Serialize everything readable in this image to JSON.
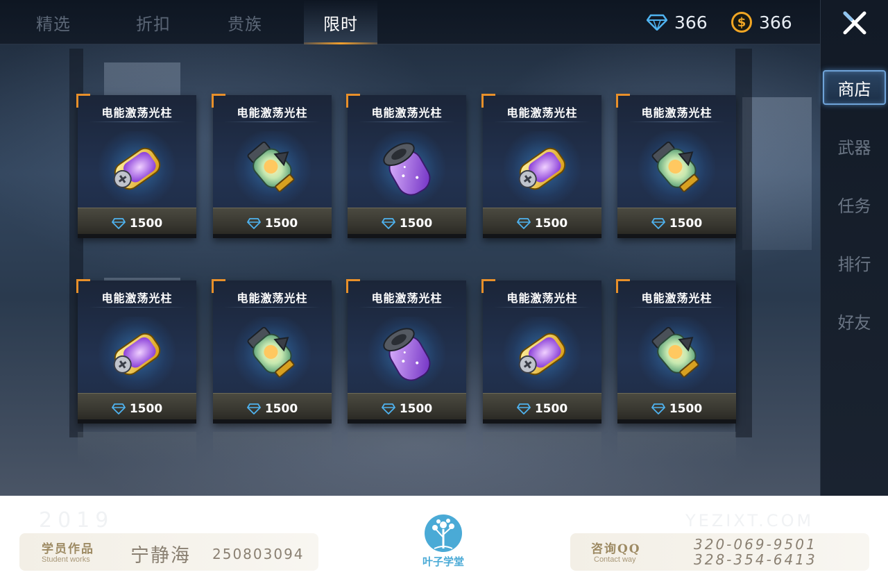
{
  "tabs": [
    {
      "label": "精选"
    },
    {
      "label": "折扣"
    },
    {
      "label": "贵族"
    },
    {
      "label": "限时"
    }
  ],
  "active_tab": "限时",
  "currency": {
    "diamonds": "366",
    "coins": "366",
    "coin_symbol": "$",
    "gem_color": "#4fb3f0",
    "coin_color": "#f1a624"
  },
  "side_nav": [
    {
      "label": "商店"
    },
    {
      "label": "武器"
    },
    {
      "label": "任务"
    },
    {
      "label": "排行"
    },
    {
      "label": "好友"
    }
  ],
  "active_nav": "商店",
  "items": [
    {
      "name": "电能激荡光柱",
      "price": "1500",
      "art": "yellow-capsule"
    },
    {
      "name": "电能激荡光柱",
      "price": "1500",
      "art": "green-bottle"
    },
    {
      "name": "电能激荡光柱",
      "price": "1500",
      "art": "purple-canister"
    },
    {
      "name": "电能激荡光柱",
      "price": "1500",
      "art": "yellow-capsule"
    },
    {
      "name": "电能激荡光柱",
      "price": "1500",
      "art": "green-bottle"
    },
    {
      "name": "电能激荡光柱",
      "price": "1500",
      "art": "yellow-capsule"
    },
    {
      "name": "电能激荡光柱",
      "price": "1500",
      "art": "green-bottle"
    },
    {
      "name": "电能激荡光柱",
      "price": "1500",
      "art": "purple-canister"
    },
    {
      "name": "电能激荡光柱",
      "price": "1500",
      "art": "yellow-capsule"
    },
    {
      "name": "电能激荡光柱",
      "price": "1500",
      "art": "green-bottle"
    }
  ],
  "footer": {
    "year": "2019",
    "watermark": "YEZIXT.COM",
    "student_title": "学员作品",
    "student_sub": "Student works",
    "student_name": "宁静海",
    "student_id": "250803094",
    "logo_text": "叶子学堂",
    "contact_title": "咨询QQ",
    "contact_sub": "Contact way",
    "phone_1": "320-069-9501",
    "phone_2": "328-354-6413"
  }
}
